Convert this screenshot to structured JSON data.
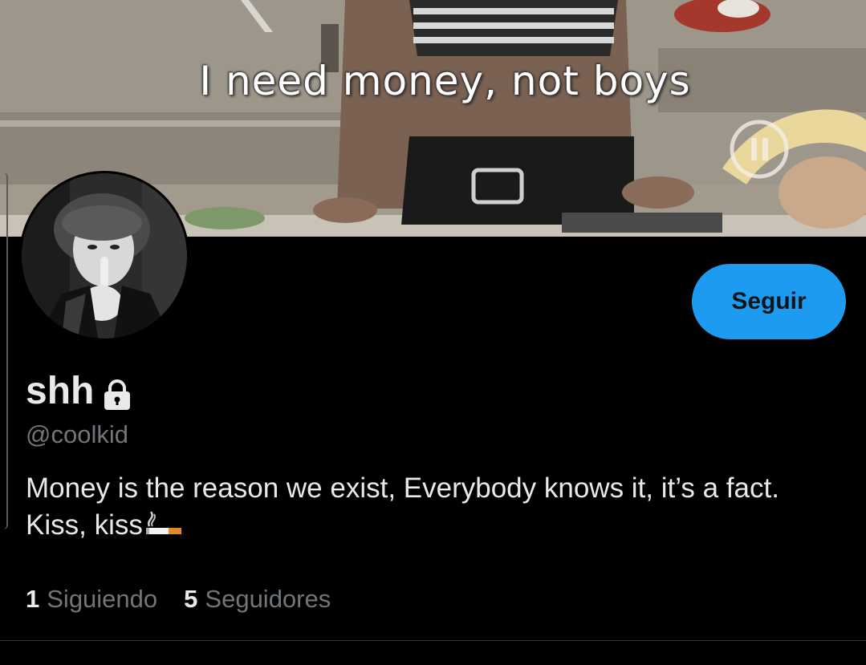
{
  "banner": {
    "caption": "I need money, not boys"
  },
  "profile": {
    "display_name": "shh",
    "handle": "@coolkid",
    "bio": "Money is the reason we exist, Everybody knows it, it’s a fact. Kiss, kiss",
    "protected": true
  },
  "actions": {
    "follow_label": "Seguir"
  },
  "stats": {
    "following_count": "1",
    "following_label": "Siguiendo",
    "followers_count": "5",
    "followers_label": "Seguidores"
  },
  "icons": {
    "lock": "lock-icon",
    "cigarette": "cigarette-icon"
  },
  "colors": {
    "background": "#000000",
    "accent": "#1d9bf0",
    "primary_text": "#e7e9ea",
    "secondary_text": "#71767b"
  }
}
